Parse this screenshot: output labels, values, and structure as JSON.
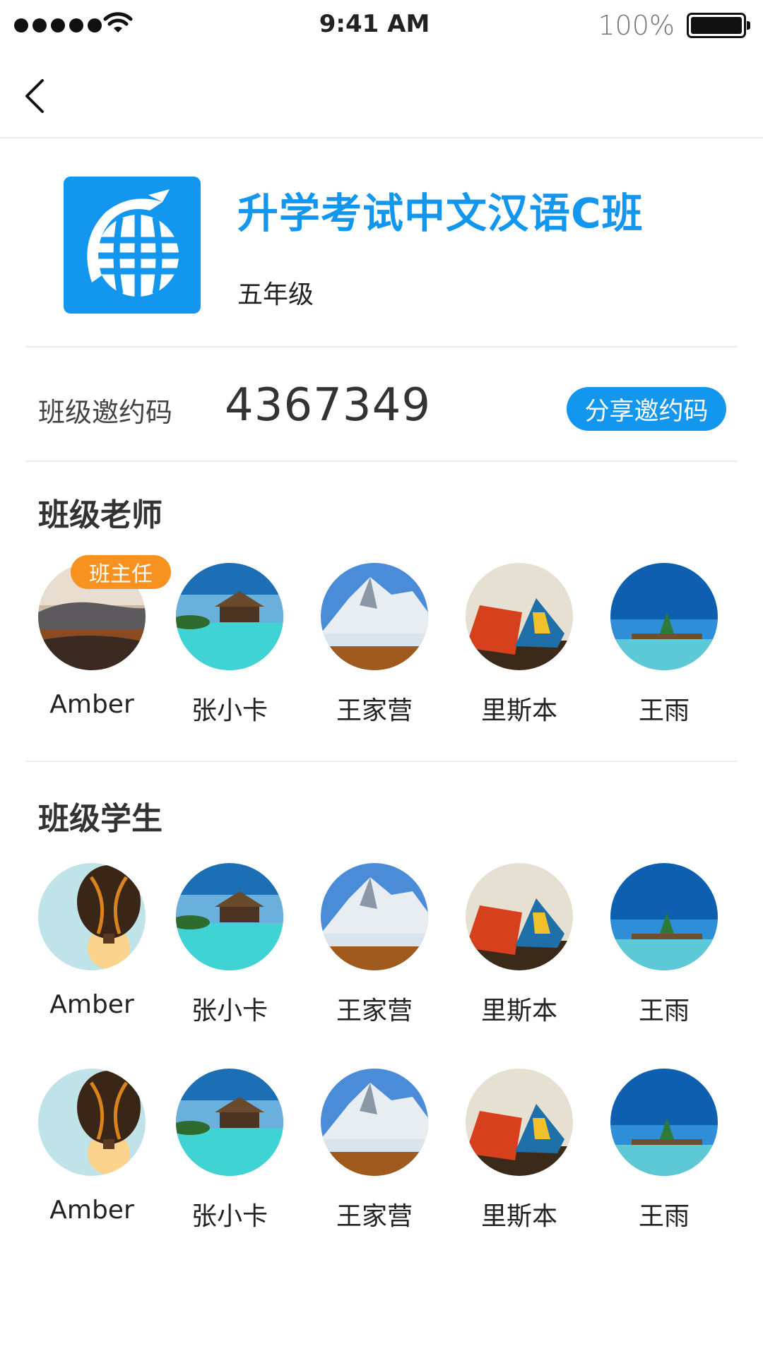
{
  "status": {
    "time": "9:41 AM",
    "battery": "100%"
  },
  "class_info": {
    "title": "升学考试中文汉语C班",
    "grade": "五年级"
  },
  "invite": {
    "label": "班级邀约码",
    "code": "4367349",
    "share_label": "分享邀约码"
  },
  "teachers": {
    "title": "班级老师",
    "head_badge": "班主任",
    "members": [
      {
        "name": "Amber",
        "photo": "desert-hills"
      },
      {
        "name": "张小卡",
        "photo": "beach-hut"
      },
      {
        "name": "王家营",
        "photo": "snow-mountain"
      },
      {
        "name": "里斯本",
        "photo": "tents"
      },
      {
        "name": "王雨",
        "photo": "ocean-pier"
      }
    ]
  },
  "students": {
    "title": "班级学生",
    "rows": [
      [
        {
          "name": "Amber",
          "photo": "hot-air-balloon"
        },
        {
          "name": "张小卡",
          "photo": "beach-hut"
        },
        {
          "name": "王家营",
          "photo": "snow-mountain"
        },
        {
          "name": "里斯本",
          "photo": "tents"
        },
        {
          "name": "王雨",
          "photo": "ocean-pier"
        }
      ],
      [
        {
          "name": "Amber",
          "photo": "hot-air-balloon"
        },
        {
          "name": "张小卡",
          "photo": "beach-hut"
        },
        {
          "name": "王家营",
          "photo": "snow-mountain"
        },
        {
          "name": "里斯本",
          "photo": "tents"
        },
        {
          "name": "王雨",
          "photo": "ocean-pier"
        }
      ]
    ]
  },
  "colors": {
    "accent": "#1296ee",
    "badge": "#f7911f"
  }
}
